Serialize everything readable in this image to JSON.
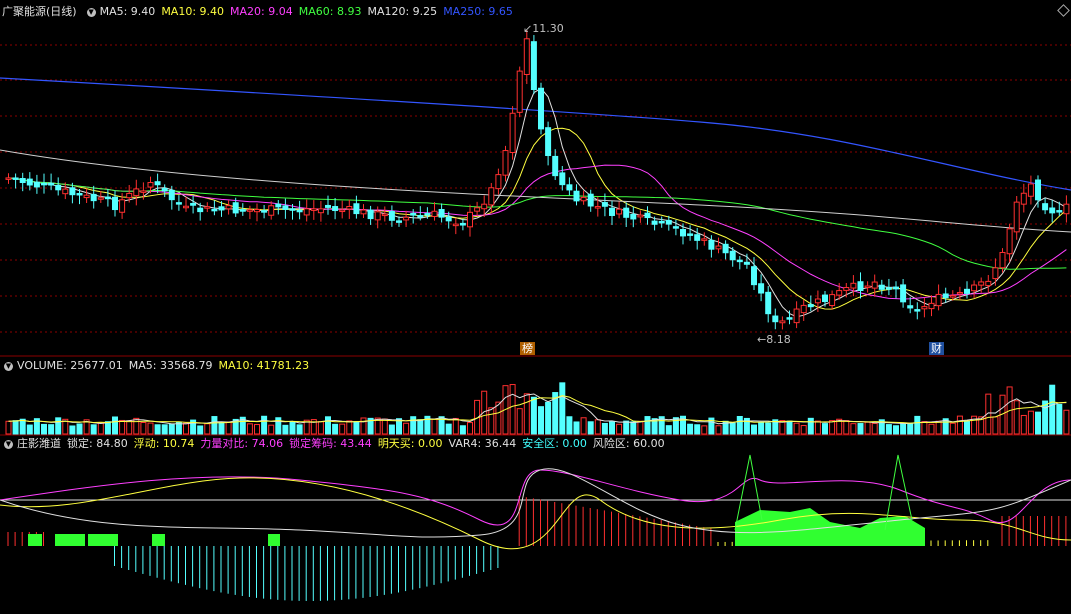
{
  "main_header": {
    "title": "广聚能源(日线)",
    "indicators": [
      {
        "label": "MA5: 9.40",
        "color": "#e0e0e0"
      },
      {
        "label": "MA10: 9.40",
        "color": "#ffff40"
      },
      {
        "label": "MA20: 9.04",
        "color": "#ff40ff"
      },
      {
        "label": "MA60: 8.93",
        "color": "#40ff40"
      },
      {
        "label": "MA120: 9.25",
        "color": "#e0e0e0"
      },
      {
        "label": "MA250: 9.65",
        "color": "#3355ff"
      }
    ]
  },
  "price": {
    "high_label": "11.30",
    "low_label": "8.18",
    "tag_bang": "榜",
    "tag_cai": "财"
  },
  "volume_header": {
    "items": [
      {
        "label": "VOLUME: 25677.01",
        "color": "#e0e0e0"
      },
      {
        "label": "MA5: 33568.79",
        "color": "#e0e0e0"
      },
      {
        "label": "MA10: 41781.23",
        "color": "#ffff40"
      }
    ]
  },
  "indicator_header": {
    "items": [
      {
        "label": "庄影潍道",
        "color": "#e0e0e0"
      },
      {
        "label": "锁定: 84.80",
        "color": "#e0e0e0"
      },
      {
        "label": "浮动: 10.74",
        "color": "#ffff40"
      },
      {
        "label": "力量对比: 74.06",
        "color": "#ff40ff"
      },
      {
        "label": "锁定筹码: 43.44",
        "color": "#ff40ff"
      },
      {
        "label": "明天买: 0.00",
        "color": "#ffff40"
      },
      {
        "label": "VAR4: 36.44",
        "color": "#e0e0e0"
      },
      {
        "label": "安全区: 0.00",
        "color": "#40ffff"
      },
      {
        "label": "风险区: 60.00",
        "color": "#e0e0e0"
      }
    ]
  },
  "colors": {
    "up": "#ff3030",
    "down": "#54ffff",
    "grid": "#8b0000",
    "ma5": "#e0e0e0",
    "ma10": "#ffff40",
    "ma20": "#ff40ff",
    "ma60": "#40ff40",
    "ma120": "#d0d0d0",
    "ma250": "#3355ff"
  }
}
